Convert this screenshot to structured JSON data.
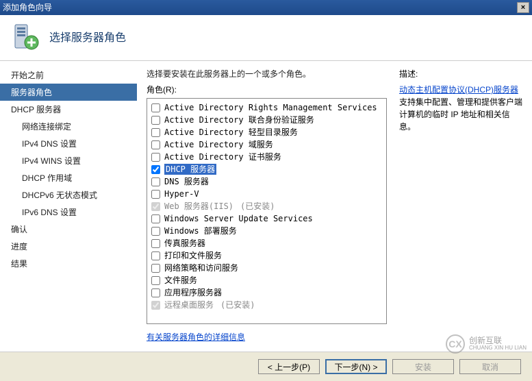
{
  "window": {
    "title": "添加角色向导",
    "close": "×"
  },
  "header": {
    "title": "选择服务器角色"
  },
  "sidebar": {
    "items": [
      {
        "label": "开始之前",
        "selected": false,
        "sub": false
      },
      {
        "label": "服务器角色",
        "selected": true,
        "sub": false
      },
      {
        "label": "DHCP 服务器",
        "selected": false,
        "sub": false
      },
      {
        "label": "网络连接绑定",
        "selected": false,
        "sub": true
      },
      {
        "label": "IPv4 DNS 设置",
        "selected": false,
        "sub": true
      },
      {
        "label": "IPv4 WINS 设置",
        "selected": false,
        "sub": true
      },
      {
        "label": "DHCP 作用域",
        "selected": false,
        "sub": true
      },
      {
        "label": "DHCPv6 无状态模式",
        "selected": false,
        "sub": true
      },
      {
        "label": "IPv6 DNS 设置",
        "selected": false,
        "sub": true
      },
      {
        "label": "确认",
        "selected": false,
        "sub": false
      },
      {
        "label": "进度",
        "selected": false,
        "sub": false
      },
      {
        "label": "结果",
        "selected": false,
        "sub": false
      }
    ]
  },
  "main": {
    "instruction": "选择要安装在此服务器上的一个或多个角色。",
    "roles_label": "角色(R):",
    "desc_label": "描述:",
    "roles": [
      {
        "label": "Active Directory Rights Management Services",
        "checked": false,
        "disabled": false,
        "installed": false,
        "selected": false
      },
      {
        "label": "Active Directory 联合身份验证服务",
        "checked": false,
        "disabled": false,
        "installed": false,
        "selected": false
      },
      {
        "label": "Active Directory 轻型目录服务",
        "checked": false,
        "disabled": false,
        "installed": false,
        "selected": false
      },
      {
        "label": "Active Directory 域服务",
        "checked": false,
        "disabled": false,
        "installed": false,
        "selected": false
      },
      {
        "label": "Active Directory 证书服务",
        "checked": false,
        "disabled": false,
        "installed": false,
        "selected": false
      },
      {
        "label": "DHCP 服务器",
        "checked": true,
        "disabled": false,
        "installed": false,
        "selected": true
      },
      {
        "label": "DNS 服务器",
        "checked": false,
        "disabled": false,
        "installed": false,
        "selected": false
      },
      {
        "label": "Hyper-V",
        "checked": false,
        "disabled": false,
        "installed": false,
        "selected": false
      },
      {
        "label": "Web 服务器(IIS)",
        "checked": true,
        "disabled": true,
        "installed": true,
        "selected": false
      },
      {
        "label": "Windows Server Update Services",
        "checked": false,
        "disabled": false,
        "installed": false,
        "selected": false
      },
      {
        "label": "Windows 部署服务",
        "checked": false,
        "disabled": false,
        "installed": false,
        "selected": false
      },
      {
        "label": "传真服务器",
        "checked": false,
        "disabled": false,
        "installed": false,
        "selected": false
      },
      {
        "label": "打印和文件服务",
        "checked": false,
        "disabled": false,
        "installed": false,
        "selected": false
      },
      {
        "label": "网络策略和访问服务",
        "checked": false,
        "disabled": false,
        "installed": false,
        "selected": false
      },
      {
        "label": "文件服务",
        "checked": false,
        "disabled": false,
        "installed": false,
        "selected": false
      },
      {
        "label": "应用程序服务器",
        "checked": false,
        "disabled": false,
        "installed": false,
        "selected": false
      },
      {
        "label": "远程桌面服务",
        "checked": true,
        "disabled": true,
        "installed": true,
        "selected": false
      }
    ],
    "installed_tag": "(已安装)",
    "description_link": "动态主机配置协议(DHCP)服务器",
    "description_rest": "支持集中配置、管理和提供客户端计算机的临时 IP 地址和相关信息。",
    "more_info_link": "有关服务器角色的详细信息"
  },
  "buttons": {
    "prev": "< 上一步(P)",
    "next": "下一步(N) >",
    "install": "安装",
    "cancel": "取消"
  },
  "watermark": {
    "brand1": "创新互联",
    "brand2": "CHUANG XIN HU LIAN"
  }
}
